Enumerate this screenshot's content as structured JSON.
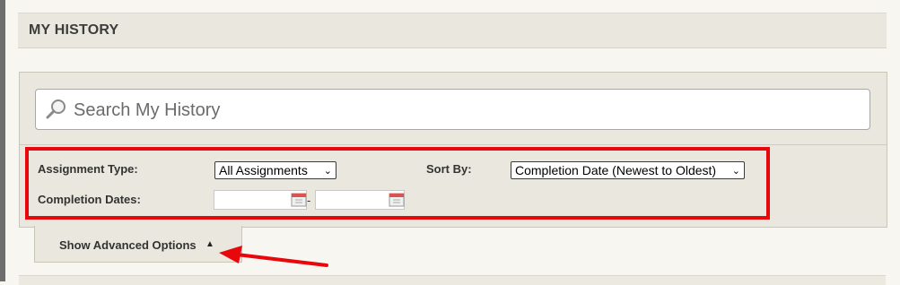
{
  "header": {
    "title": "MY HISTORY"
  },
  "search": {
    "placeholder": "Search My History"
  },
  "filters": {
    "assignment_type_label": "Assignment Type:",
    "assignment_type_value": "All Assignments",
    "sort_by_label": "Sort By:",
    "sort_by_value": "Completion Date (Newest to Oldest)",
    "completion_dates_label": "Completion Dates:",
    "date_separator": "-"
  },
  "advanced": {
    "label": "Show Advanced Options"
  },
  "colors": {
    "highlight": "#e8070b",
    "panel": "#e9e7de",
    "background": "#f7f6f1"
  },
  "icons": [
    "search-icon",
    "calendar-icon",
    "caret-up-icon",
    "arrow-annotation"
  ]
}
